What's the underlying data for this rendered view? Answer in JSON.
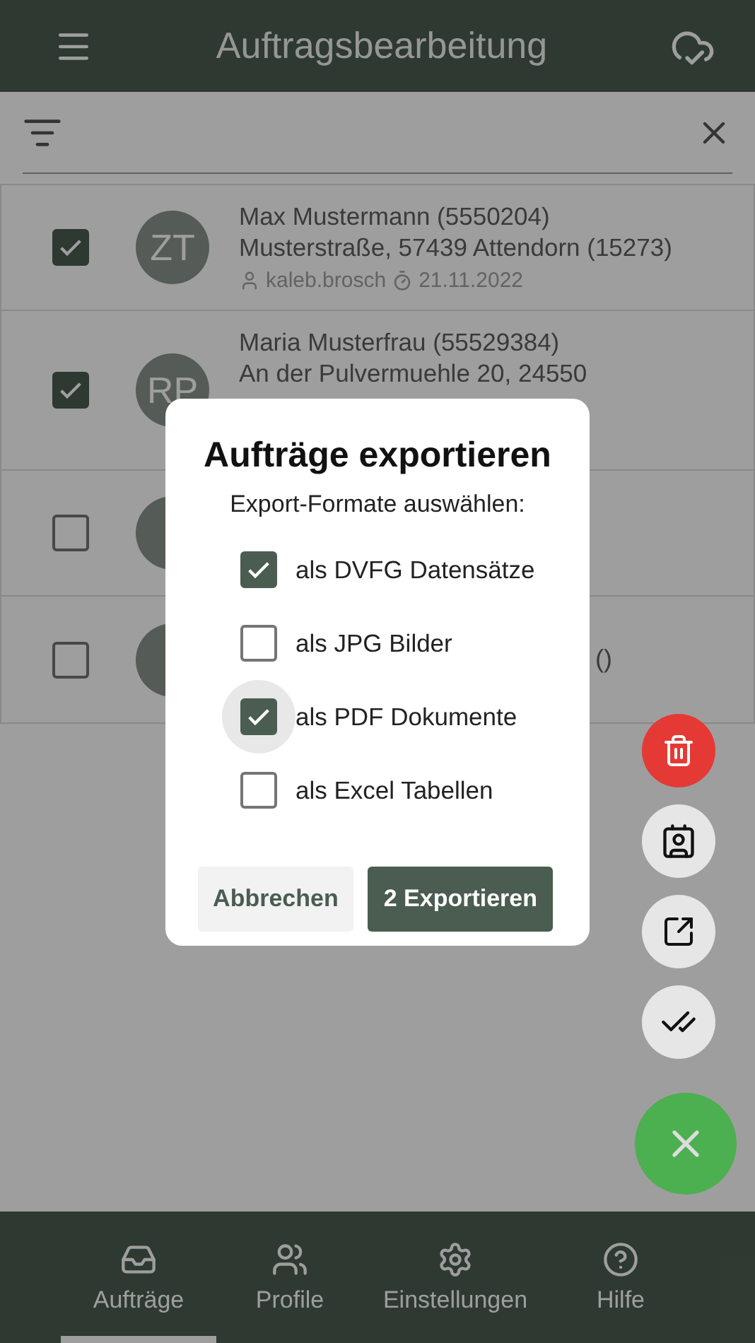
{
  "app_bar": {
    "title": "Auftragsbearbeitung"
  },
  "orders": [
    {
      "checked": true,
      "initials": "ZT",
      "lines": [
        "Max Mustermann (5550204)",
        "Musterstraße, 57439 Attendorn (15273)"
      ],
      "user": "kaleb.brosch",
      "date": "21.11.2022"
    },
    {
      "checked": true,
      "initials": "RP",
      "lines": [
        "Maria Musterfrau (55529384)",
        "An der Pulvermuehle 20, 24550"
      ]
    },
    {
      "checked": false
    },
    {
      "checked": false,
      "trailing": "()"
    }
  ],
  "dialog": {
    "title": "Aufträge exportieren",
    "subtitle": "Export-Formate auswählen:",
    "options": [
      {
        "label": "als DVFG Datensätze",
        "checked": true,
        "focused": false
      },
      {
        "label": "als JPG Bilder",
        "checked": false,
        "focused": false
      },
      {
        "label": "als PDF Dokumente",
        "checked": true,
        "focused": true
      },
      {
        "label": "als Excel Tabellen",
        "checked": false,
        "focused": false
      }
    ],
    "buttons": [
      {
        "label": "Abbrechen",
        "kind": "text"
      },
      {
        "label": "2 Exportieren",
        "kind": "filled"
      }
    ]
  },
  "nav": [
    {
      "label": "Aufträge",
      "selected": true
    },
    {
      "label": "Profile",
      "selected": false
    },
    {
      "label": "Einstellungen",
      "selected": false
    },
    {
      "label": "Hilfe",
      "selected": false
    }
  ]
}
